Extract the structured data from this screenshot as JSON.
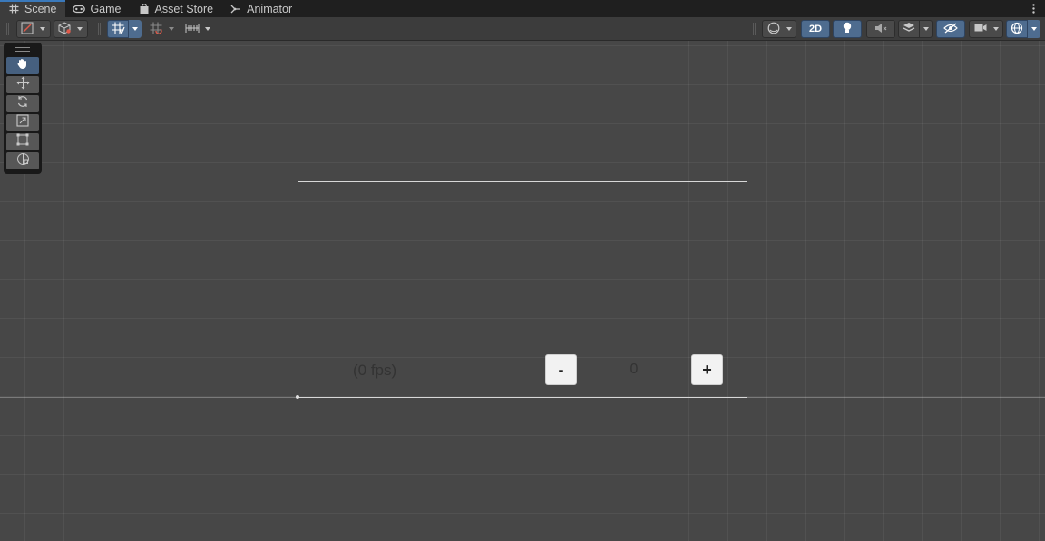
{
  "tabs": [
    {
      "label": "Scene",
      "icon": "hash-grid-icon",
      "active": true
    },
    {
      "label": "Game",
      "icon": "gamepad-icon",
      "active": false
    },
    {
      "label": "Asset Store",
      "icon": "shopping-bag-icon",
      "active": false
    },
    {
      "label": "Animator",
      "icon": "animator-icon",
      "active": false
    }
  ],
  "toolbar": {
    "mode_2d_label": "2D",
    "accent_color": "#4e6c8f"
  },
  "tools": [
    "hand-tool",
    "move-tool",
    "rotate-tool",
    "scale-tool",
    "rect-tool",
    "transform-tool"
  ],
  "scene": {
    "fps_text": "(0 fps)",
    "minus_label": "-",
    "plus_label": "+",
    "counter_value": "0"
  }
}
